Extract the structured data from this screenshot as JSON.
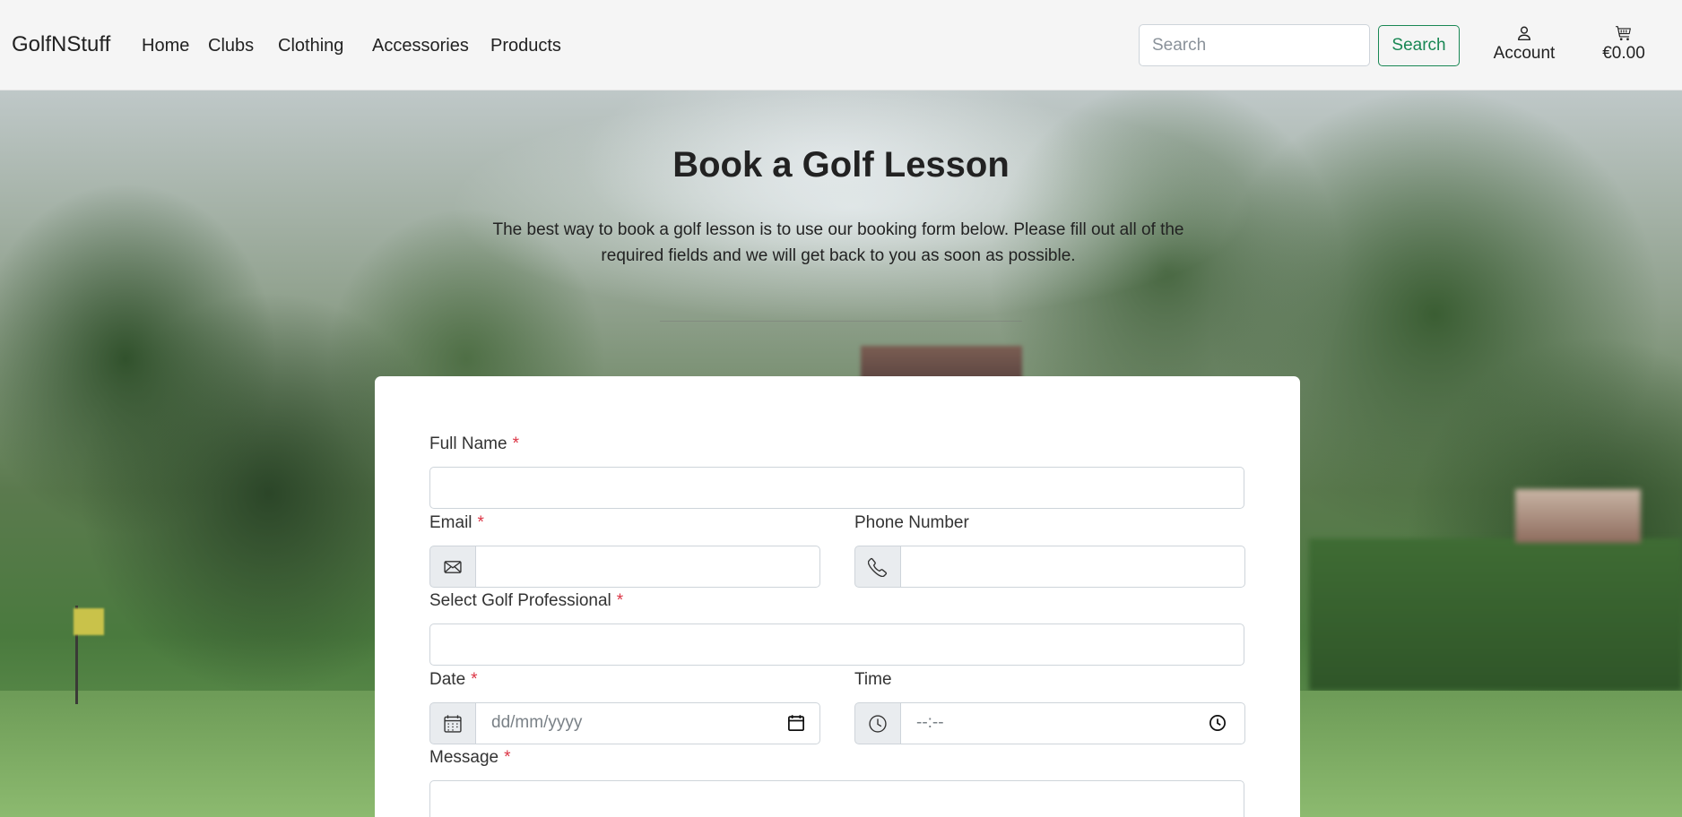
{
  "navbar": {
    "brand": "GolfNStuff",
    "links": [
      "Home",
      "Clubs",
      "Clothing",
      "Accessories",
      "Products"
    ],
    "search": {
      "placeholder": "Search",
      "button_label": "Search"
    },
    "account_label": "Account",
    "cart_total": "€0.00"
  },
  "hero": {
    "title": "Book a Golf Lesson",
    "intro": "The best way to book a golf lesson is to use our booking form below. Please fill out all of the required fields and we will get back to you as soon as possible."
  },
  "form": {
    "required_marker": "*",
    "full_name": {
      "label": "Full Name",
      "value": ""
    },
    "email": {
      "label": "Email",
      "value": ""
    },
    "phone": {
      "label": "Phone Number",
      "value": ""
    },
    "professional": {
      "label": "Select Golf Professional",
      "value": ""
    },
    "date": {
      "label": "Date",
      "placeholder": "dd/mm/yyyy"
    },
    "time": {
      "label": "Time",
      "placeholder": "--:--"
    },
    "message": {
      "label": "Message",
      "value": ""
    }
  },
  "icons": {
    "account": "person-icon",
    "cart": "cart-icon",
    "email": "envelope-icon",
    "phone": "telephone-icon",
    "date": "calendar-icon",
    "time": "clock-icon"
  },
  "colors": {
    "navbar_bg": "#f5f5f5",
    "search_button": "#198754",
    "required": "#dc3545",
    "addon_bg": "#e9ecef",
    "card_bg": "#ffffff"
  }
}
